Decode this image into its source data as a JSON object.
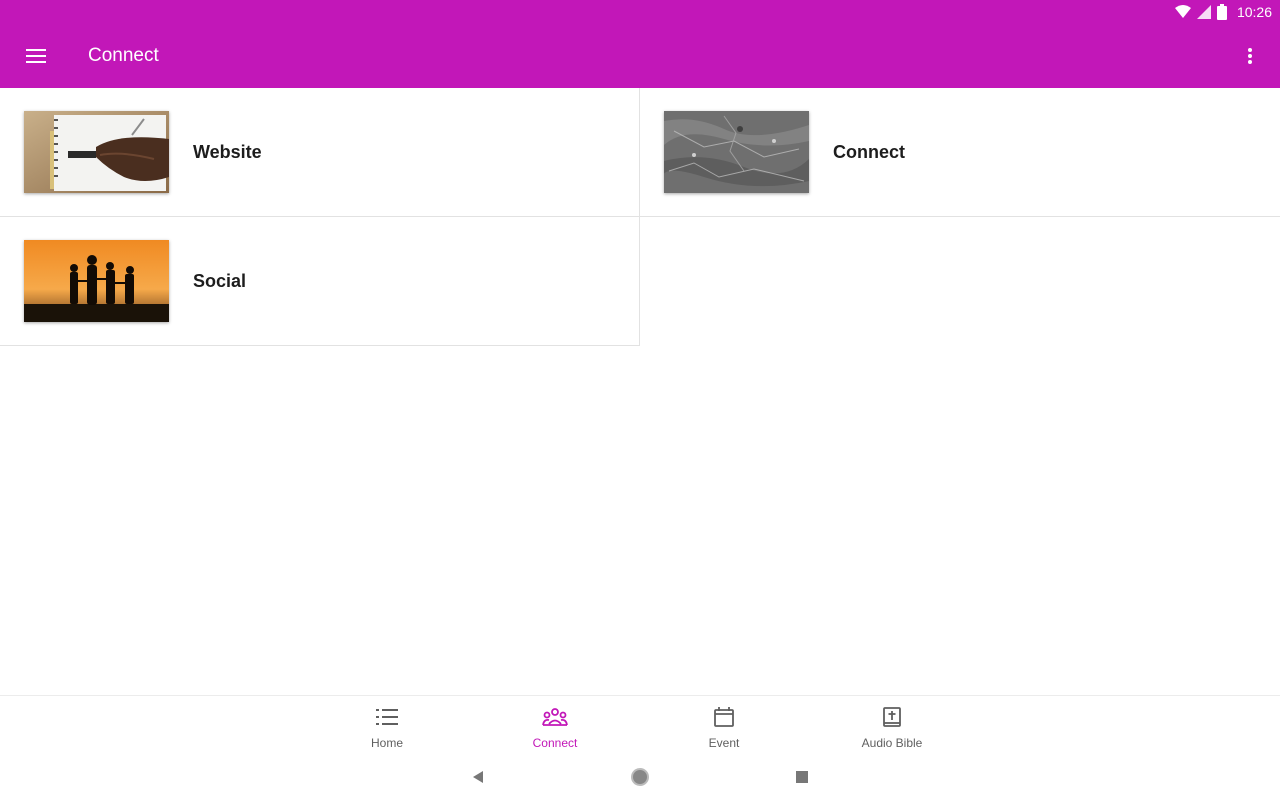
{
  "status_bar": {
    "time": "10:26",
    "icons": [
      "wifi-icon",
      "signal-icon",
      "battery-icon"
    ]
  },
  "app_bar": {
    "title": "Connect",
    "menu_icon": "hamburger-menu-icon",
    "overflow_icon": "more-vertical-icon"
  },
  "cards": [
    {
      "title": "Website",
      "image": "notebook-writing-image"
    },
    {
      "title": "Connect",
      "image": "gray-stone-texture-image"
    },
    {
      "title": "Social",
      "image": "family-sunset-silhouette-image"
    }
  ],
  "bottom_nav": {
    "items": [
      {
        "label": "Home",
        "icon": "list-icon",
        "active": false
      },
      {
        "label": "Connect",
        "icon": "people-group-icon",
        "active": true
      },
      {
        "label": "Event",
        "icon": "calendar-icon",
        "active": false
      },
      {
        "label": "Audio Bible",
        "icon": "bible-cross-icon",
        "active": false
      }
    ]
  },
  "colors": {
    "primary": "#c217b8",
    "inactive_nav": "#5f5f5f",
    "card_title": "#1d1d1d",
    "divider": "#e2e2e2"
  },
  "system_nav": {
    "buttons": [
      "back-icon",
      "home-circle-icon",
      "recents-square-icon"
    ]
  }
}
